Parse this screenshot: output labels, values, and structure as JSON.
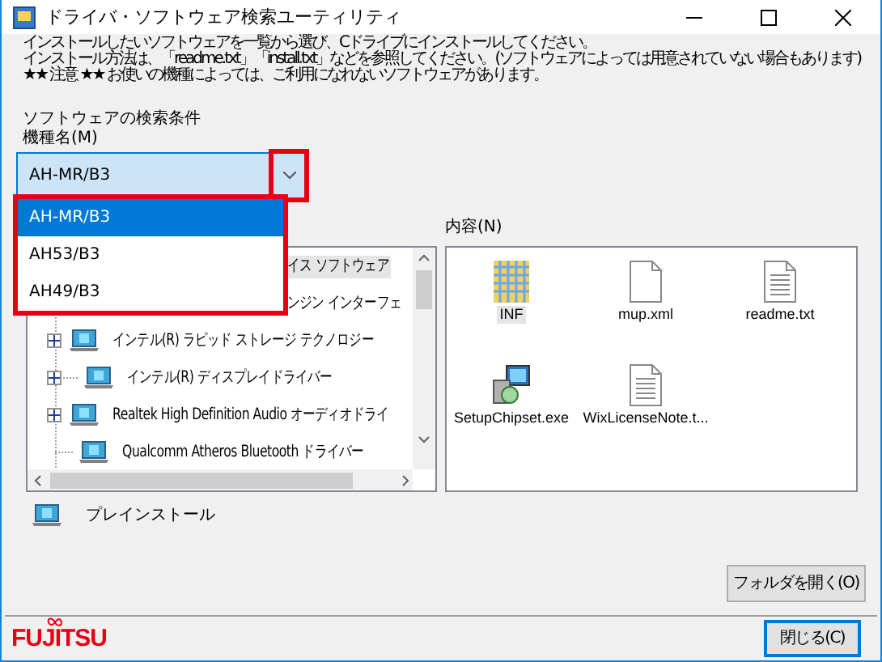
{
  "window": {
    "title": "ドライバ・ソフトウェア検索ユーティリティ"
  },
  "instructions": [
    "インストールしたいソフトウェアを一覧から選び、Cドライブにインストールしてください。",
    "インストール方法は、「readme.txt」「install.txt」などを参照してください。(ソフトウェアによっては用意されていない場合もあります)",
    "★★ 注意 ★★ お使いの機種によっては、ご利用になれないソフトウェアがあります。"
  ],
  "search_section": {
    "title": "ソフトウェアの検索条件",
    "model_label": "機種名(M)",
    "model_value": "AH-MR/B3"
  },
  "model_options": [
    {
      "label": "AH-MR/B3",
      "selected": true
    },
    {
      "label": "AH53/B3",
      "selected": false
    },
    {
      "label": "AH49/B3",
      "selected": false
    }
  ],
  "tree": [
    {
      "kind": "covered",
      "label": "イス ソフトウェア",
      "selected": true
    },
    {
      "kind": "covered",
      "label": "ンジン インターフェ",
      "selected": false
    },
    {
      "kind": "item",
      "label": "インテル(R) ラピッド ストレージ テクノロジー",
      "expandable": true,
      "selected": false
    },
    {
      "kind": "item",
      "label": "インテル(R) ディスプレイドライバー",
      "expandable": true,
      "selected": false
    },
    {
      "kind": "item",
      "label": "Realtek High Definition Audio オーディオドライ",
      "expandable": true,
      "selected": false
    },
    {
      "kind": "item",
      "label": "Qualcomm Atheros Bluetooth ドライバー",
      "expandable": false,
      "selected": false
    }
  ],
  "contents": {
    "label": "内容(N)",
    "files": [
      {
        "kind": "grid",
        "name": "INF",
        "selected": true
      },
      {
        "kind": "blank",
        "name": "mup.xml",
        "selected": false
      },
      {
        "kind": "text",
        "name": "readme.txt",
        "selected": false
      },
      {
        "kind": "installer",
        "name": "SetupChipset.exe",
        "selected": false
      },
      {
        "kind": "text",
        "name": "WixLicenseNote.t...",
        "selected": false
      }
    ]
  },
  "legend": {
    "label": "プレインストール"
  },
  "buttons": {
    "open_folder": "フォルダを開く(O)",
    "close": "閉じる(C)"
  },
  "logo": "FUJITSU"
}
